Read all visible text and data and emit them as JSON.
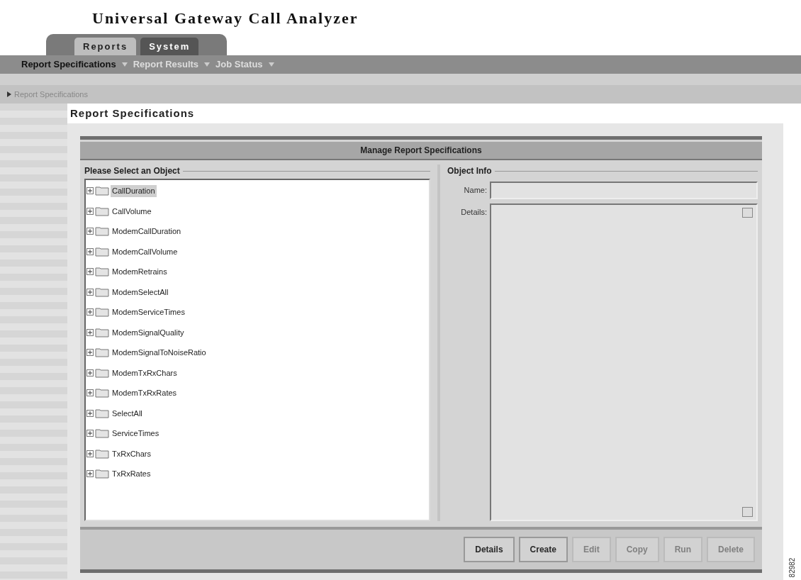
{
  "app_title": "Universal Gateway Call Analyzer",
  "tabs": [
    {
      "label": "Reports",
      "selected": true
    },
    {
      "label": "System",
      "selected": false
    }
  ],
  "menu": [
    {
      "label": "Report Specifications",
      "selected": true
    },
    {
      "label": "Report Results",
      "selected": false
    },
    {
      "label": "Job Status",
      "selected": false
    }
  ],
  "breadcrumb": "Report Specifications",
  "page_heading": "Report Specifications",
  "panel": {
    "title": "Manage Report Specifications",
    "tree": {
      "legend": "Please Select an Object",
      "items": [
        {
          "label": "CallDuration",
          "selected": true,
          "expanded": false
        },
        {
          "label": "CallVolume",
          "selected": false,
          "expanded": false
        },
        {
          "label": "ModemCallDuration",
          "selected": false,
          "expanded": false
        },
        {
          "label": "ModemCallVolume",
          "selected": false,
          "expanded": false
        },
        {
          "label": "ModemRetrains",
          "selected": false,
          "expanded": false
        },
        {
          "label": "ModemSelectAll",
          "selected": false,
          "expanded": false
        },
        {
          "label": "ModemServiceTimes",
          "selected": false,
          "expanded": false
        },
        {
          "label": "ModemSignalQuality",
          "selected": false,
          "expanded": false
        },
        {
          "label": "ModemSignalToNoiseRatio",
          "selected": false,
          "expanded": false
        },
        {
          "label": "ModemTxRxChars",
          "selected": false,
          "expanded": false
        },
        {
          "label": "ModemTxRxRates",
          "selected": false,
          "expanded": false
        },
        {
          "label": "SelectAll",
          "selected": false,
          "expanded": false
        },
        {
          "label": "ServiceTimes",
          "selected": false,
          "expanded": false
        },
        {
          "label": "TxRxChars",
          "selected": false,
          "expanded": false
        },
        {
          "label": "TxRxRates",
          "selected": false,
          "expanded": false
        }
      ]
    },
    "object_info": {
      "legend": "Object Info",
      "name_label": "Name:",
      "details_label": "Details:"
    },
    "buttons": [
      {
        "label": "Details",
        "disabled": false
      },
      {
        "label": "Create",
        "disabled": false
      },
      {
        "label": "Edit",
        "disabled": true
      },
      {
        "label": "Copy",
        "disabled": true
      },
      {
        "label": "Run",
        "disabled": true
      },
      {
        "label": "Delete",
        "disabled": true
      }
    ]
  },
  "figure_number": "82982"
}
